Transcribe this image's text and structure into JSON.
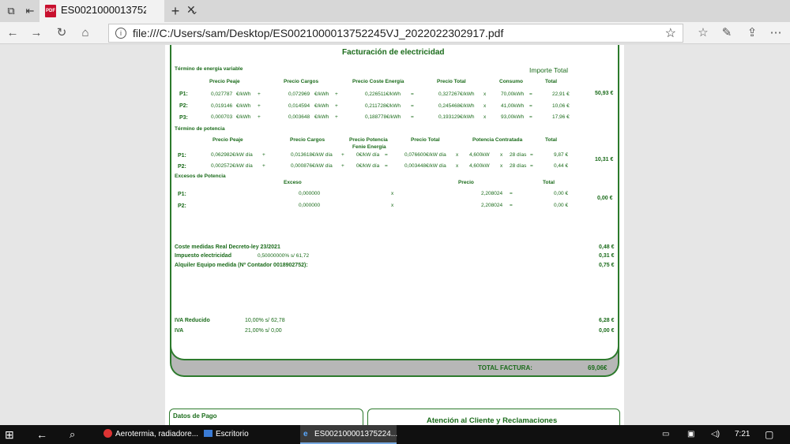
{
  "browser": {
    "tab_title": "ES00210000137522",
    "pdf_badge": "PDF",
    "url": "file:///C:/Users/sam/Desktop/ES0021000013752245VJ_2022022302917.pdf"
  },
  "invoice": {
    "title": "Facturación de electricidad",
    "importe_total_label": "Importe Total",
    "energia": {
      "heading": "Término de energía variable",
      "headers": [
        "Precio Peaje",
        "Precio Cargos",
        "Precio Coste Energía",
        "Precio Total",
        "Consumo",
        "Total"
      ],
      "rows": [
        {
          "label": "P1:",
          "peaje": "0,027787",
          "peaje_unit": "€/kWh",
          "plus1": "+",
          "cargos": "0,072969",
          "cargos_unit": "€/kWh",
          "plus2": "+",
          "coste": "0,226511€/kWh",
          "eq": "=",
          "total_precio": "0,327267€/kWh",
          "x": "x",
          "consumo": "70,00kWh",
          "eq2": "=",
          "total": "22,91 €"
        },
        {
          "label": "P2:",
          "peaje": "0,019146",
          "peaje_unit": "€/kWh",
          "plus1": "+",
          "cargos": "0,014594",
          "cargos_unit": "€/kWh",
          "plus2": "+",
          "coste": "0,211728€/kWh",
          "eq": "=",
          "total_precio": "0,245468€/kWh",
          "x": "x",
          "consumo": "41,00kWh",
          "eq2": "=",
          "total": "10,06 €"
        },
        {
          "label": "P3:",
          "peaje": "0,000703",
          "peaje_unit": "€/kWh",
          "plus1": "+",
          "cargos": "0,003648",
          "cargos_unit": "€/kWh",
          "plus2": "+",
          "coste": "0,188778€/kWh",
          "eq": "=",
          "total_precio": "0,193129€/kWh",
          "x": "x",
          "consumo": "93,00kWh",
          "eq2": "=",
          "total": "17,96 €"
        }
      ],
      "section_total": "50,93 €"
    },
    "potencia": {
      "heading": "Término de potencia",
      "headers": [
        "Precio Peaje",
        "Precio Cargos",
        "Precio Potencia",
        "Fenie Energía",
        "Precio Total",
        "Potencia Contratada",
        "Total"
      ],
      "rows": [
        {
          "label": "P1:",
          "peaje": "0,062982€/kW día",
          "plus1": "+",
          "cargos": "0,013618€/kW día",
          "plus2": "+",
          "potencia": "0€/kW día",
          "eq": "=",
          "total_precio": "0,076600€/kW día",
          "x": "x",
          "contratada": "4,600kW",
          "x2": "x",
          "dias": "28 días",
          "eq2": "=",
          "total": "9,87 €"
        },
        {
          "label": "P2:",
          "peaje": "0,002572€/kW día",
          "plus1": "+",
          "cargos": "0,000876€/kW día",
          "plus2": "+",
          "potencia": "0€/kW día",
          "eq": "=",
          "total_precio": "0,003448€/kW día",
          "x": "x",
          "contratada": "4,600kW",
          "x2": "x",
          "dias": "28 días",
          "eq2": "=",
          "total": "0,44 €"
        }
      ],
      "section_total": "10,31 €"
    },
    "excesos": {
      "heading": "Excesos de Potencia",
      "headers": [
        "Exceso",
        "Precio",
        "Total"
      ],
      "rows": [
        {
          "label": "P1:",
          "exceso": "0,000000",
          "x": "x",
          "precio": "2,208024",
          "eq": "=",
          "total": "0,00 €"
        },
        {
          "label": "P2:",
          "exceso": "0,000000",
          "x": "x",
          "precio": "2,208024",
          "eq": "=",
          "total": "0,00 €"
        }
      ],
      "section_total": "0,00 €"
    },
    "otros": [
      {
        "label": "Coste medidas Real Decreto-ley 23/2021",
        "detail": "",
        "value": "0,48 €"
      },
      {
        "label": "Impuesto electricidad",
        "detail": "0,50000000% s/ 61,72",
        "value": "0,31 €"
      },
      {
        "label": "Alquiler Equipo medida (Nº Contador 0018902752):",
        "detail": "",
        "value": "0,75 €"
      }
    ],
    "iva": [
      {
        "label": "IVA Reducido",
        "detail": "10,00% s/ 62,78",
        "value": "6,28 €"
      },
      {
        "label": "IVA",
        "detail": "21,00% s/ 0,00",
        "value": "0,00 €"
      }
    ],
    "total_label": "TOTAL FACTURA:",
    "total_value": "69,06€",
    "datos_pago": "Datos de Pago",
    "atencion": "Atención al Cliente y Reclamaciones"
  },
  "taskbar": {
    "items": [
      "Aerotermia, radiadore...",
      "Escritorio",
      "ES002100001375224..."
    ],
    "time": "7:21"
  }
}
